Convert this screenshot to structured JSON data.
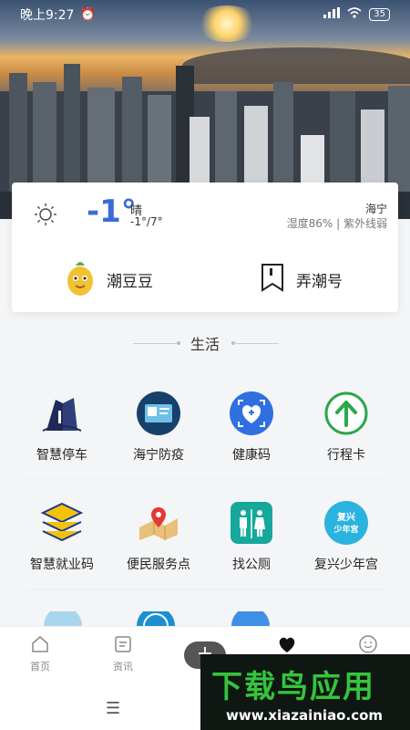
{
  "status_bar": {
    "time": "晚上9:27",
    "battery": "35",
    "signal": "4G"
  },
  "weather": {
    "temperature": "-1°",
    "condition": "晴",
    "range": "-1°/7°",
    "city": "海宁",
    "details": "湿度86% | 紫外线弱"
  },
  "quick_links": [
    {
      "label": "潮豆豆",
      "icon": "mascot-icon"
    },
    {
      "label": "弄潮号",
      "icon": "bookmark-icon"
    }
  ],
  "section_title": "生活",
  "services": [
    {
      "label": "智慧停车",
      "icon": "parking-building-icon"
    },
    {
      "label": "海宁防疫",
      "icon": "epidemic-card-icon"
    },
    {
      "label": "健康码",
      "icon": "health-code-icon"
    },
    {
      "label": "行程卡",
      "icon": "itinerary-arrow-icon"
    },
    {
      "label": "智慧就业码",
      "icon": "layers-icon"
    },
    {
      "label": "便民服务点",
      "icon": "map-pin-icon"
    },
    {
      "label": "找公厕",
      "icon": "restroom-icon"
    },
    {
      "label": "复兴少年宫",
      "icon": "youth-palace-badge"
    }
  ],
  "youth_palace_badge_text": "复兴\n少年宫",
  "bottom_nav": [
    {
      "label": "首页",
      "icon": "home-icon"
    },
    {
      "label": "资讯",
      "icon": "news-icon"
    },
    {
      "label": "",
      "icon": "heart-icon"
    },
    {
      "label": "",
      "icon": "smile-icon"
    }
  ],
  "watermark": {
    "title": "下载鸟应用",
    "url": "www.xiazainiao.com"
  },
  "colors": {
    "accent": "#3b6bd6",
    "health": "#2f6fe0",
    "itinerary": "#2aa84a",
    "restroom": "#16a89b"
  }
}
